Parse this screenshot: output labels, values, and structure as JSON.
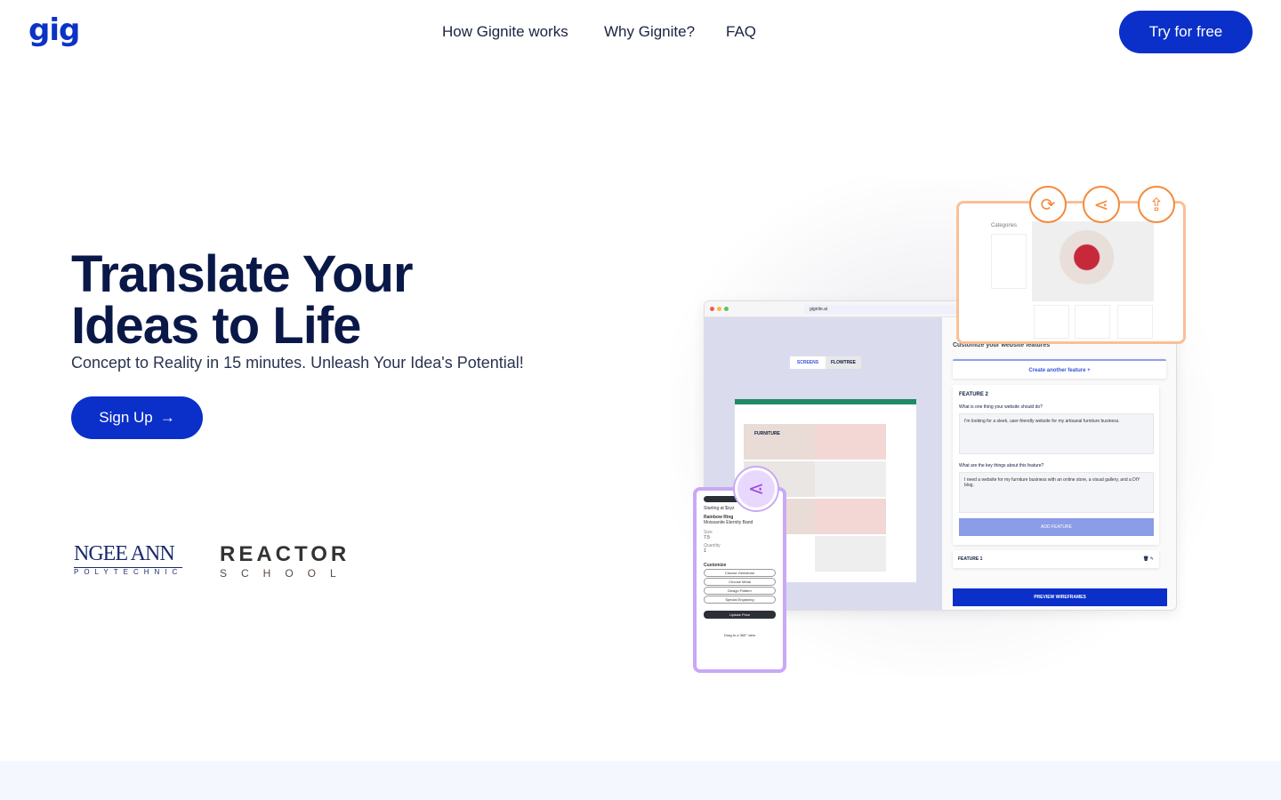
{
  "header": {
    "logo": "gig",
    "nav": [
      "How Gignite works",
      "Why Gignite?",
      "FAQ"
    ],
    "cta": "Try for free"
  },
  "hero": {
    "title_line1": "Translate Your",
    "title_line2": "Ideas to Life",
    "subtitle": "Concept to Reality in 15 minutes. Unleash Your Idea's Potential!",
    "signup": "Sign Up",
    "signup_icon": "arrow-right"
  },
  "partners": {
    "ngee_ann": {
      "name": "NGEE ANN",
      "sub": "POLYTECHNIC"
    },
    "reactor": {
      "name": "REACTOR",
      "sub": "SCHOOL"
    }
  },
  "mockup": {
    "url": "gignite.ai",
    "tabs": [
      "SCREENS",
      "FLOWTREE"
    ],
    "site_label": "FURNITURE",
    "panel_title": "Customize your website features",
    "create_feature": "Create another feature +",
    "feature2": "FEATURE 2",
    "q1": "What is one thing your website should do?",
    "a1": "I'm looking for a sleek, user-friendly website for my artisanal furniture business.",
    "q2": "What are the key things about this feature?",
    "a2": "I need a website for my furniture business with an online store, a visual gallery, and a DIY blog.",
    "add_feature": "ADD FEATURE",
    "feature1": "FEATURE 1",
    "preview": "PREVIEW WIREFRAMES",
    "categories_title": "Categories",
    "phone": {
      "price": "Starting at $xyz",
      "product": "Rainbow Ring",
      "variant": "Moissanite Eternity Band",
      "size_label": "Size",
      "size": "7.5",
      "qty_label": "Quantity",
      "qty": "1",
      "customize": "Customize",
      "options": [
        "Choose Gemstone",
        "Choose Metal",
        "Design Pattern",
        "Special Engraving"
      ],
      "update": "Update Price",
      "drag": "Drag to a 360° view"
    },
    "accent_orange": "#f58a3c",
    "accent_purple": "#c9a8f6",
    "brand": "#0b2fc9"
  }
}
